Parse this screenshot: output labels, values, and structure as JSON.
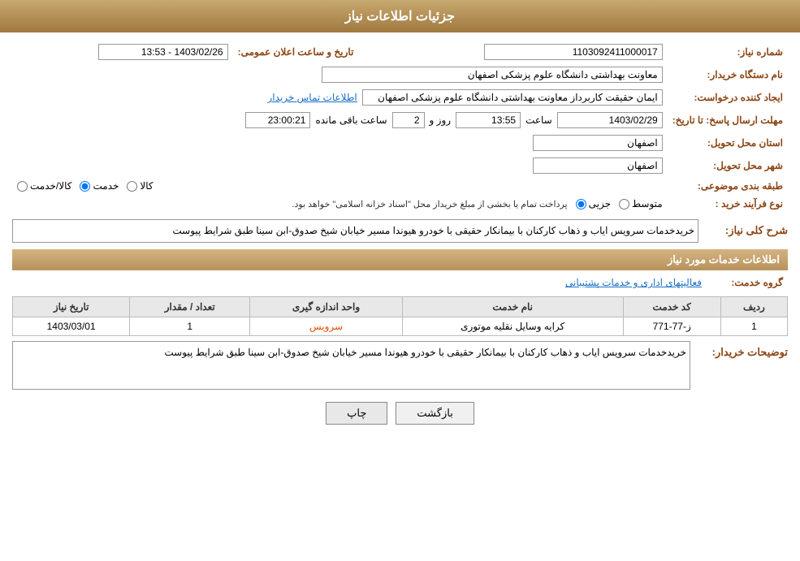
{
  "page": {
    "title": "جزئیات اطلاعات نیاز"
  },
  "header": {
    "fields": {
      "need_number_label": "شماره نیاز:",
      "need_number_value": "1103092411000017",
      "date_label": "تاریخ و ساعت اعلان عمومی:",
      "date_value": "1403/02/26 - 13:53",
      "org_name_label": "نام دستگاه خریدار:",
      "org_name_value": "معاونت بهداشتی دانشگاه علوم پزشکی اصفهان",
      "creator_label": "ایجاد کننده درخواست:",
      "creator_value": "ایمان حقیقت کاربرداز معاونت بهداشتی دانشگاه علوم پزشکی اصفهان",
      "contact_link": "اطلاعات تماس خریدار",
      "deadline_label": "مهلت ارسال پاسخ: تا تاریخ:",
      "deadline_date": "1403/02/29",
      "deadline_time_label": "ساعت",
      "deadline_time": "13:55",
      "deadline_days_label": "روز و",
      "deadline_days": "2",
      "deadline_remaining_label": "ساعت باقی مانده",
      "deadline_remaining": "23:00:21",
      "province_label": "استان محل تحویل:",
      "province_value": "اصفهان",
      "city_label": "شهر محل تحویل:",
      "city_value": "اصفهان",
      "category_label": "طبقه بندی موضوعی:",
      "category_options": [
        "کالا",
        "خدمت",
        "کالا/خدمت"
      ],
      "category_selected": "خدمت",
      "process_label": "نوع فرآیند خرید :",
      "process_options": [
        "جزیی",
        "متوسط"
      ],
      "process_selected": "جزیی",
      "process_note": "پرداخت تمام یا بخشی از مبلغ خریداز محل \"اسناد خزانه اسلامی\" خواهد بود."
    }
  },
  "description_section": {
    "title": "شرح کلی نیاز:",
    "text": "خریدخدمات سرویس ایاب و ذهاب کارکنان با بیمانکار حقیقی با خودرو هیوندا مسیر خیابان شیخ صدوق-ابن سینا طبق شرایط پیوست"
  },
  "services_section": {
    "title": "اطلاعات خدمات مورد نیاز",
    "service_group_label": "گروه خدمت:",
    "service_group_value": "فعالیتهای اداری و خدمات پشتیبانی",
    "table": {
      "headers": [
        "ردیف",
        "کد خدمت",
        "نام خدمت",
        "واحد اندازه گیری",
        "تعداد / مقدار",
        "تاریخ نیاز"
      ],
      "rows": [
        {
          "row_num": "1",
          "code": "ز-77-771",
          "name": "کرایه وسایل نقلیه موتوری",
          "unit": "سرویس",
          "quantity": "1",
          "date": "1403/03/01"
        }
      ]
    }
  },
  "buyer_notes": {
    "label": "توضیحات خریدار:",
    "text": "خریدخدمات سرویس ایاب و ذهاب کارکنان با بیمانکار حقیقی با خودرو هیوندا مسیر خیابان شیخ صدوق-ابن سینا طبق شرایط پیوست"
  },
  "buttons": {
    "print": "چاپ",
    "back": "بازگشت"
  }
}
